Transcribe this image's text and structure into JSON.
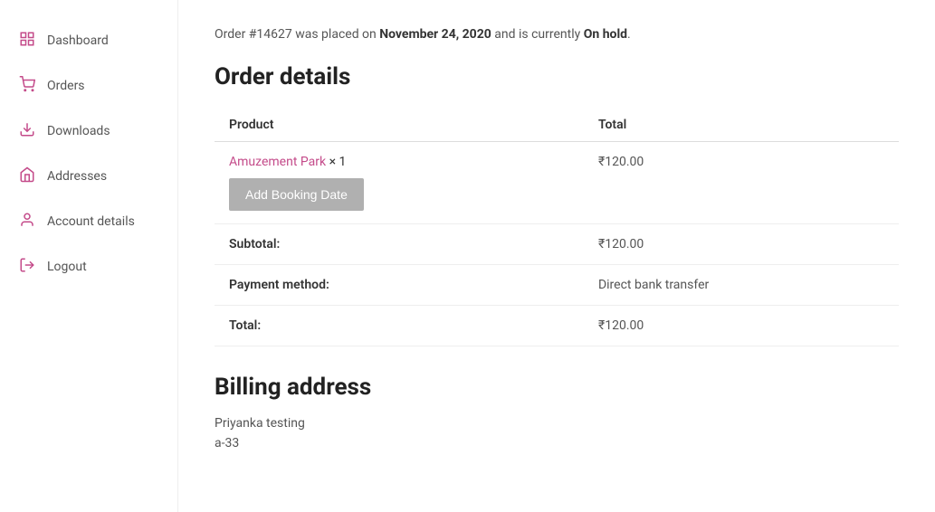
{
  "sidebar": {
    "items": [
      {
        "id": "dashboard",
        "label": "Dashboard",
        "icon": "👤"
      },
      {
        "id": "orders",
        "label": "Orders",
        "icon": "🛒"
      },
      {
        "id": "downloads",
        "label": "Downloads",
        "icon": "📄"
      },
      {
        "id": "addresses",
        "label": "Addresses",
        "icon": "🏠"
      },
      {
        "id": "account-details",
        "label": "Account details",
        "icon": "👤"
      },
      {
        "id": "logout",
        "label": "Logout",
        "icon": "→"
      }
    ]
  },
  "order": {
    "notice_prefix": "Order #",
    "order_number": "14627",
    "notice_mid1": " was placed on ",
    "date": "November 24, 2020",
    "notice_mid2": " and is currently ",
    "status": "On hold",
    "notice_suffix": ".",
    "section_title": "Order details",
    "table_headers": {
      "product": "Product",
      "total": "Total"
    },
    "product_name": "Amuzement Park",
    "product_qty": "× 1",
    "product_total": "₹120.00",
    "add_booking_label": "Add Booking Date",
    "subtotal_label": "Subtotal:",
    "subtotal_value": "₹120.00",
    "payment_method_label": "Payment method:",
    "payment_method_value": "Direct bank transfer",
    "total_label": "Total:",
    "total_value": "₹120.00"
  },
  "billing": {
    "section_title": "Billing address",
    "name": "Priyanka testing",
    "address_line": "a-33"
  }
}
